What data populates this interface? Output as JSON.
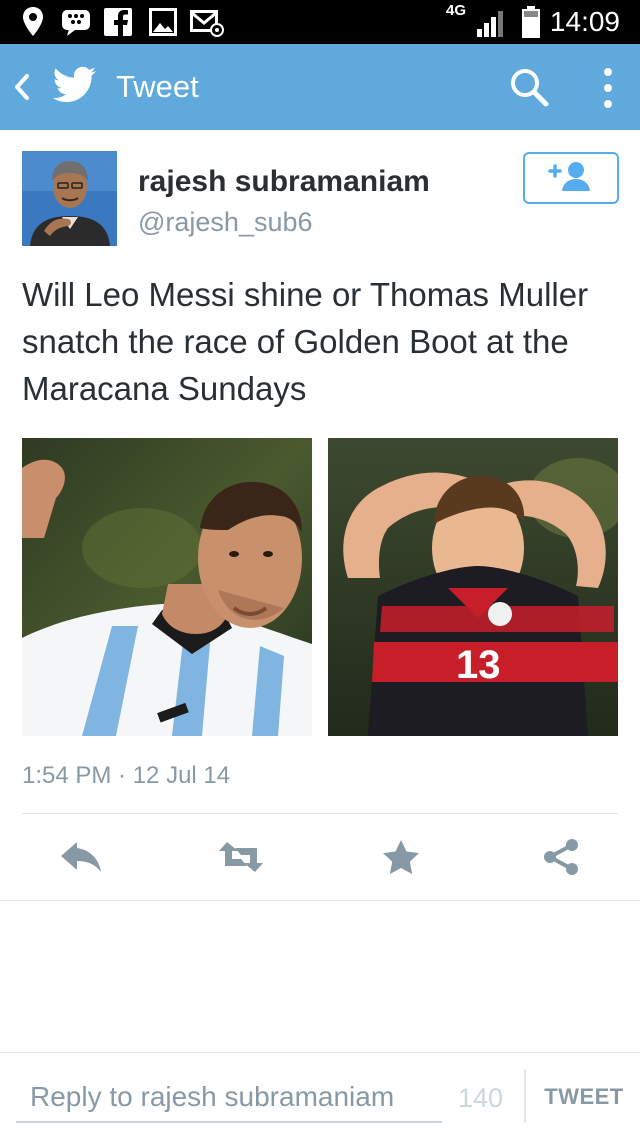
{
  "status_bar": {
    "time": "14:09",
    "network": "4G",
    "icons": [
      "location-icon",
      "bbm-icon",
      "facebook-icon",
      "gallery-icon",
      "email-icon",
      "signal-icon",
      "battery-icon"
    ]
  },
  "app_bar": {
    "title": "Tweet",
    "color": "#5fa9dd",
    "icons": [
      "back-icon",
      "twitter-bird-icon",
      "search-icon",
      "overflow-menu-icon"
    ]
  },
  "tweet": {
    "author": {
      "display_name": "rajesh subramaniam",
      "screen_name": "@rajesh_sub6"
    },
    "follow_icon": "add-user-icon",
    "text": "Will Leo Messi shine or Thomas Muller snatch the race of Golden Boot at the Maracana Sundays",
    "media": [
      {
        "alt": "Leo Messi in Argentina jersey"
      },
      {
        "alt": "Thomas Muller in Germany jersey number 13",
        "jersey_number": "13"
      }
    ],
    "timestamp": "1:54 PM · 12 Jul 14",
    "actions": [
      "reply-icon",
      "retweet-icon",
      "favorite-icon",
      "share-icon"
    ]
  },
  "reply_bar": {
    "placeholder": "Reply to rajesh subramaniam",
    "char_count": "140",
    "tweet_label": "TWEET"
  },
  "colors": {
    "accent": "#55acee",
    "text": "#292f33",
    "muted": "#8899a6"
  }
}
